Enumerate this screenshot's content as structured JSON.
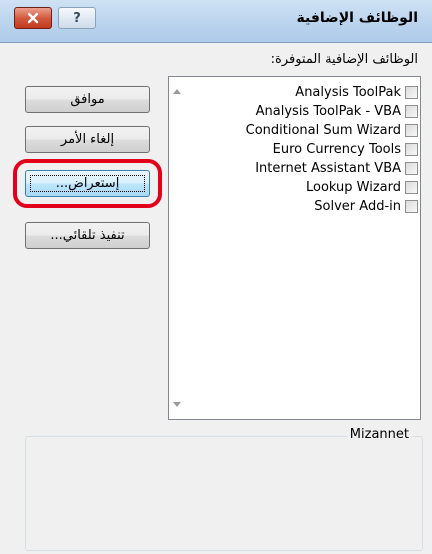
{
  "window": {
    "title": "الوظائف الإضافية",
    "help_glyph": "?",
    "close_icon": "close-x-icon",
    "help_icon": "question-mark-icon"
  },
  "list": {
    "label": "الوظائف الإضافية المتوفرة:",
    "items": [
      {
        "label": "Analysis ToolPak",
        "checked": false
      },
      {
        "label": "Analysis ToolPak - VBA",
        "checked": false
      },
      {
        "label": "Conditional Sum Wizard",
        "checked": false
      },
      {
        "label": "Euro Currency Tools",
        "checked": false
      },
      {
        "label": "Internet Assistant VBA",
        "checked": false
      },
      {
        "label": "Lookup Wizard",
        "checked": false
      },
      {
        "label": "Solver Add-in",
        "checked": false
      }
    ]
  },
  "buttons": {
    "ok": "موافق",
    "cancel": "إلغاء الأمر",
    "browse": "إستعراض...",
    "automation": "تنفيذ تلقائي..."
  },
  "group": {
    "title": "Mizannet"
  },
  "colors": {
    "titlebar": "#bed6ee",
    "close_button": "#c23a1d",
    "highlight_ring": "#e3001b",
    "browse_button_focus": "#3c7fb1"
  }
}
